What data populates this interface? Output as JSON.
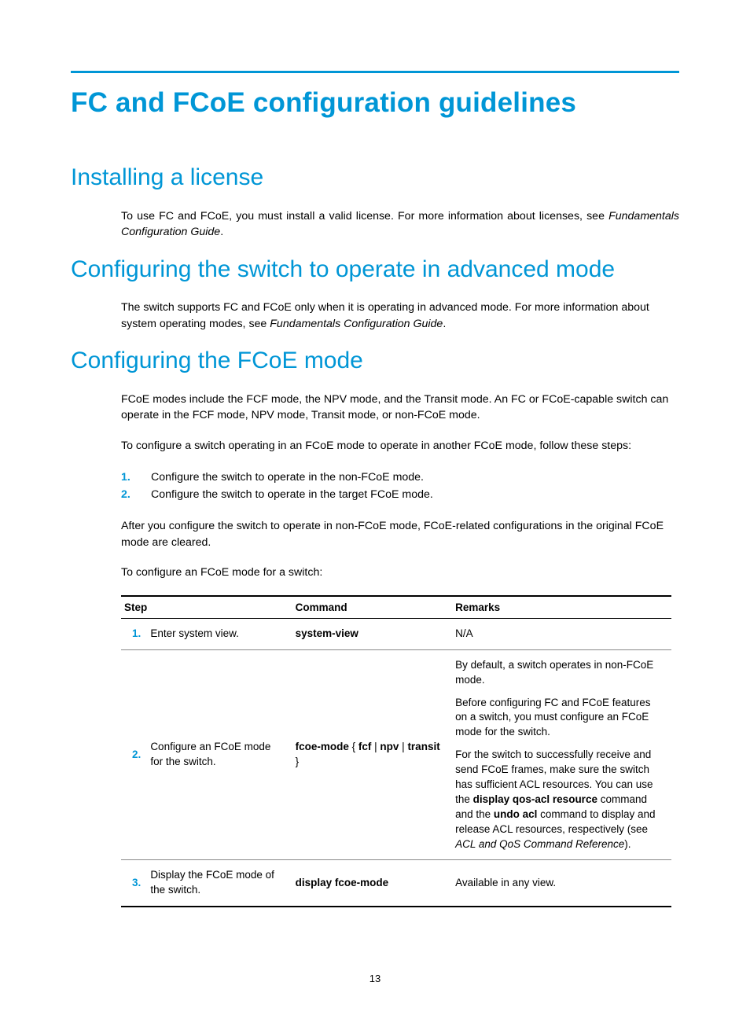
{
  "title": "FC and FCoE configuration guidelines",
  "sections": {
    "licensing": {
      "heading": "Installing a license",
      "body_pre": "To use FC and FCoE, you must install a valid license. For more information about licenses, see ",
      "body_em": "Fundamentals Configuration Guide",
      "body_post": "."
    },
    "advanced": {
      "heading": "Configuring the switch to operate in advanced mode",
      "body_pre": "The switch supports FC and FCoE only when it is operating in advanced mode. For more information about system operating modes, see ",
      "body_em": "Fundamentals Configuration Guide",
      "body_post": "."
    },
    "fcoe": {
      "heading": "Configuring the FCoE mode",
      "p1": "FCoE modes include the FCF mode, the NPV mode, and the Transit mode. An FC or FCoE-capable switch can operate in the FCF mode, NPV mode, Transit mode, or non-FCoE mode.",
      "p2": "To configure a switch operating in an FCoE mode to operate in another FCoE mode, follow these steps:",
      "steps": [
        "Configure the switch to operate in the non-FCoE mode.",
        "Configure the switch to operate in the target FCoE mode."
      ],
      "p3": "After you configure the switch to operate in non-FCoE mode, FCoE-related configurations in the original FCoE mode are cleared.",
      "p4": "To configure an FCoE mode for a switch:"
    }
  },
  "table": {
    "headers": {
      "step": "Step",
      "command": "Command",
      "remarks": "Remarks"
    },
    "rows": [
      {
        "num": "1.",
        "step": "Enter system view.",
        "command": "system-view",
        "remarks_plain": "N/A"
      },
      {
        "num": "2.",
        "step": "Configure an FCoE mode for the switch.",
        "command_parts": {
          "p1": "fcoe-mode",
          "sep1": " { ",
          "p2": "fcf",
          "sep2": " | ",
          "p3": "npv",
          "sep3": " | ",
          "p4": "transit",
          "sep4": " }"
        },
        "remarks": {
          "r1": "By default, a switch operates in non-FCoE mode.",
          "r2": "Before configuring FC and FCoE features on a switch, you must configure an FCoE mode for the switch.",
          "r3_pre": "For the switch to successfully receive and send FCoE frames, make sure the switch has sufficient ACL resources. You can use the ",
          "r3_b1": "display qos-acl resource",
          "r3_mid": " command and the ",
          "r3_b2": "undo acl",
          "r3_post": " command to display and release ACL resources, respectively (see ",
          "r3_em": "ACL and QoS Command Reference",
          "r3_end": ")."
        }
      },
      {
        "num": "3.",
        "step": "Display the FCoE mode of the switch.",
        "command": "display fcoe-mode",
        "remarks_plain": "Available in any view."
      }
    ]
  },
  "page_number": "13"
}
